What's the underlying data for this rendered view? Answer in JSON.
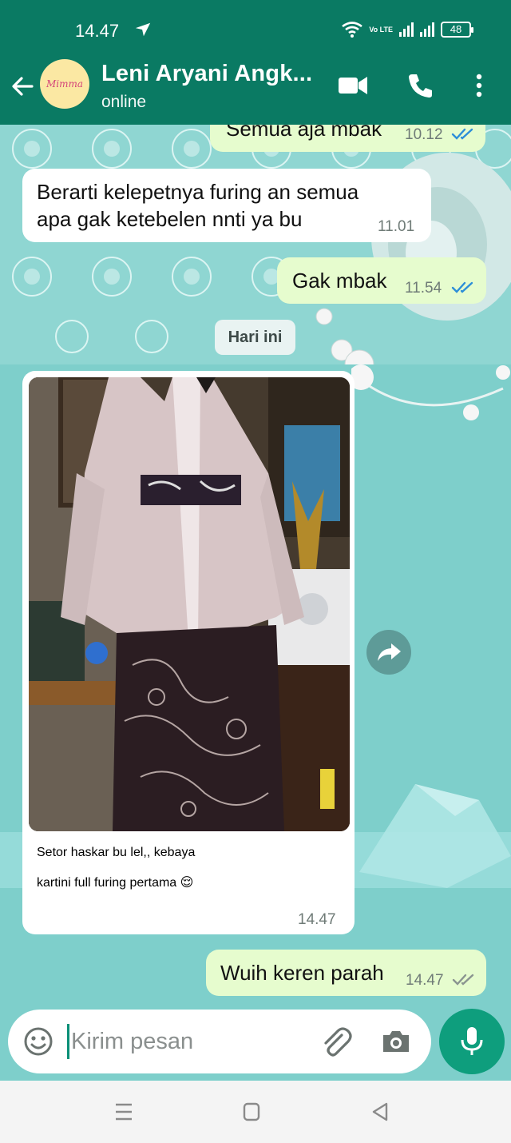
{
  "status_bar": {
    "time": "14.47",
    "network": "Vo LTE",
    "battery": "48"
  },
  "header": {
    "avatar_text": "Mimma",
    "contact_name": "Leni Aryani Angk...",
    "contact_status": "online"
  },
  "messages": [
    {
      "direction": "out",
      "text": "Semua aja mbak",
      "time": "10.12",
      "read": true
    },
    {
      "direction": "in",
      "text_lines": [
        "Berarti kelepetnya furing an semua",
        "apa gak ketebelen nnti ya bu"
      ],
      "time": "11.01"
    },
    {
      "direction": "out",
      "text": "Gak mbak",
      "time": "11.54",
      "read": true
    },
    {
      "type": "date",
      "text": "Hari ini"
    },
    {
      "direction": "in",
      "type": "image",
      "caption_lines": [
        "Setor haskar bu lel,, kebaya",
        "kartini full furing pertama 😌"
      ],
      "time": "14.47"
    },
    {
      "direction": "out",
      "text": "Wuih keren parah",
      "time": "14.47",
      "read": false
    }
  ],
  "input": {
    "placeholder": "Kirim pesan"
  },
  "colors": {
    "header": "#0a7a63",
    "chat_bg": "#7ecfcb",
    "outgoing": "#e6fcce",
    "incoming": "#ffffff",
    "read_ticks": "#2d8fd8",
    "mic": "#0e9e7d"
  }
}
